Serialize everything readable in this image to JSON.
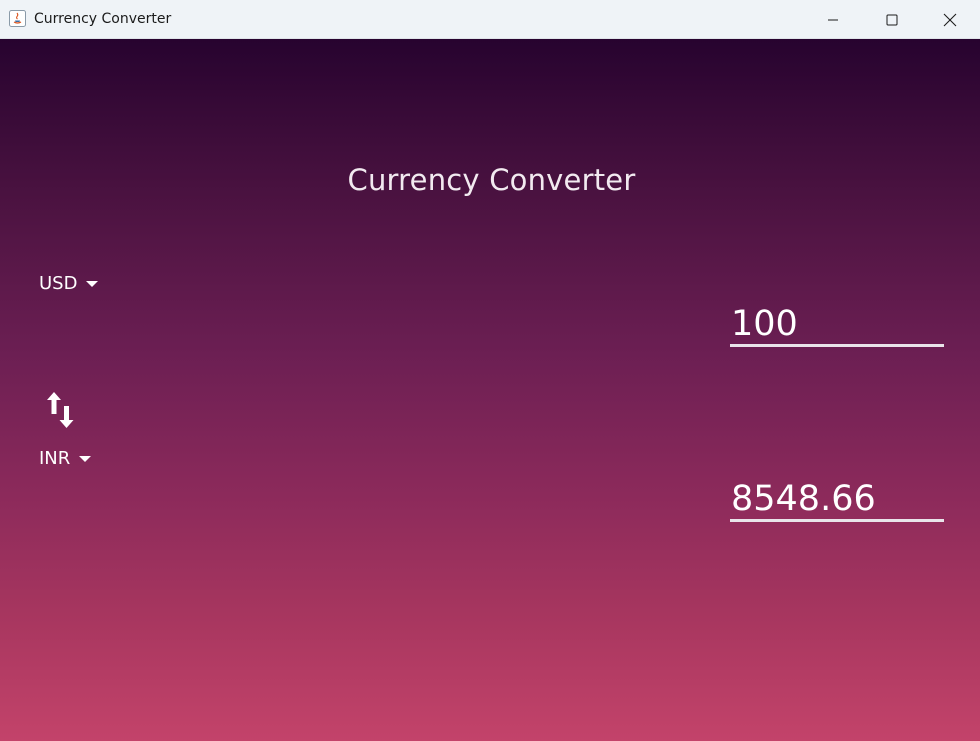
{
  "window": {
    "title": "Currency Converter",
    "controls": {
      "minimize_icon": "minimize-icon",
      "maximize_icon": "maximize-icon",
      "close_icon": "close-icon"
    }
  },
  "app": {
    "heading": "Currency Converter",
    "from": {
      "currency": "USD",
      "amount": "100"
    },
    "to": {
      "currency": "INR",
      "amount": "8548.66"
    },
    "swap_icon": "swap-vertical-icon"
  },
  "colors": {
    "gradient_top": "#27032f",
    "gradient_bottom": "#c3436a",
    "text": "#ffffff",
    "underline": "#e9e4ea",
    "titlebar": "#eff3f7"
  }
}
